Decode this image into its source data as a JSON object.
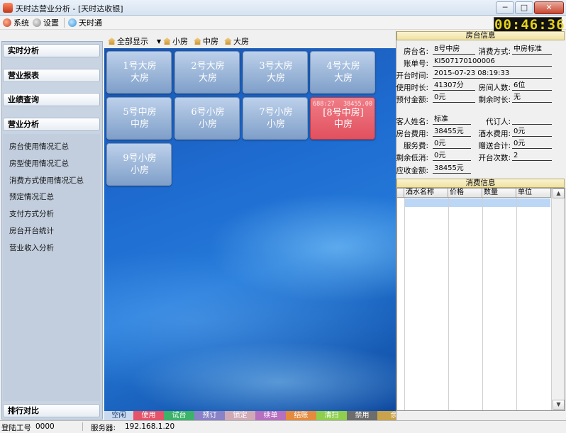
{
  "window": {
    "title": "天时达营业分析 - [天时达收银]",
    "min_label": "─",
    "max_label": "□",
    "close_label": "✕"
  },
  "menu": {
    "system": "系统",
    "settings": "设置",
    "tianshitong": "天时通"
  },
  "clock": "00:46:36",
  "sidebar": {
    "sections": [
      {
        "label": "实时分析"
      },
      {
        "label": "营业报表"
      },
      {
        "label": "业绩查询"
      },
      {
        "label": "营业分析"
      }
    ],
    "items": [
      {
        "label": "房台使用情况汇总"
      },
      {
        "label": "房型使用情况汇总"
      },
      {
        "label": "消费方式使用情况汇总"
      },
      {
        "label": "预定情况汇总"
      },
      {
        "label": "支付方式分析"
      },
      {
        "label": "房台开台统计"
      },
      {
        "label": "营业收入分析"
      }
    ],
    "bottom": "排行对比"
  },
  "room_toolbar": {
    "show_all": "全部显示",
    "small": "小房",
    "medium": "中房",
    "large": "大房"
  },
  "rooms": [
    {
      "name": "1号大房",
      "type": "大房"
    },
    {
      "name": "2号大房",
      "type": "大房"
    },
    {
      "name": "3号大房",
      "type": "大房"
    },
    {
      "name": "4号大房",
      "type": "大房"
    },
    {
      "name": "5号中房",
      "type": "中房"
    },
    {
      "name": "6号小房",
      "type": "小房"
    },
    {
      "name": "7号小房",
      "type": "小房"
    },
    {
      "name": "[8号中房]",
      "type": "中房",
      "time": "688:27",
      "amount": "38455.00"
    },
    {
      "name": "9号小房",
      "type": "小房"
    }
  ],
  "legend": [
    {
      "label": "空闲",
      "color": "#c9d9ee"
    },
    {
      "label": "使用",
      "color": "#e4536a"
    },
    {
      "label": "试台",
      "color": "#3db36a"
    },
    {
      "label": "预订",
      "color": "#8a82c6"
    },
    {
      "label": "锁定",
      "color": "#cfa9b6"
    },
    {
      "label": "续单",
      "color": "#b76fc0"
    },
    {
      "label": "结账",
      "color": "#e58b3d"
    },
    {
      "label": "清扫",
      "color": "#8fcf4d"
    },
    {
      "label": "禁用",
      "color": "#6d6d6d"
    },
    {
      "label": "余时",
      "color": "#c8a34b"
    }
  ],
  "room_info": {
    "title": "房台信息",
    "room_name_label": "房台名:",
    "room_name": "8号中房",
    "consume_mode_label": "消费方式:",
    "consume_mode": "中房标准",
    "bill_no_label": "账单号:",
    "bill_no": "KI507170100006",
    "open_time_label": "开台时间:",
    "open_time": "2015-07-23 08:19:33",
    "duration_label": "使用时长:",
    "duration": "41307分",
    "guests_label": "房间人数:",
    "guests": "6位",
    "prepay_label": "预付金额:",
    "prepay": "0元",
    "remain_time_label": "剩余时长:",
    "remain_time": "无",
    "guest_name_label": "客人姓名:",
    "guest_name": "标准",
    "booker_label": "代订人:",
    "booker": "",
    "room_fee_label": "房台费用:",
    "room_fee": "38455元",
    "drink_fee_label": "酒水费用:",
    "drink_fee": "0元",
    "service_fee_label": "服务费:",
    "service_fee": "0元",
    "gift_total_label": "赠送合计:",
    "gift_total": "0元",
    "min_remain_label": "剩余低消:",
    "min_remain": "0元",
    "open_count_label": "开台次数:",
    "open_count": "2",
    "receivable_label": "应收金额:",
    "receivable": "38455元"
  },
  "consumption": {
    "title": "消费信息",
    "columns": [
      "酒水名称",
      "价格",
      "数量",
      "单位"
    ]
  },
  "status": {
    "login_label": "登陆工号",
    "login_id": "0000",
    "server_label": "服务器:",
    "server": "192.168.1.20"
  }
}
